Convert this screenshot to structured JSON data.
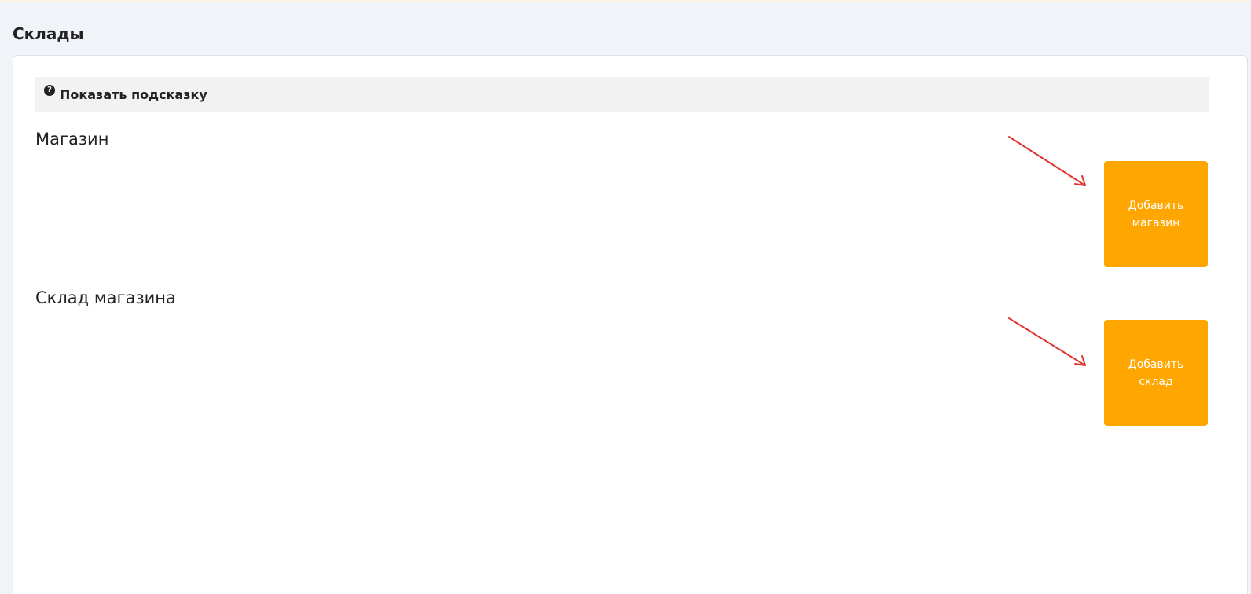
{
  "page": {
    "title": "Склады"
  },
  "hint": {
    "icon": "question-circle-icon",
    "label": "Показать подсказку"
  },
  "sections": [
    {
      "title": "Магазин",
      "add_button_label": "Добавить магазин"
    },
    {
      "title": "Склад магазина",
      "add_button_label": "Добавить склад"
    }
  ],
  "colors": {
    "page_background": "#f0f3f8",
    "card_background": "#ffffff",
    "hint_background": "#f2f2f2",
    "accent_button": "#ffa600",
    "annotation_arrow": "#e0332f"
  }
}
